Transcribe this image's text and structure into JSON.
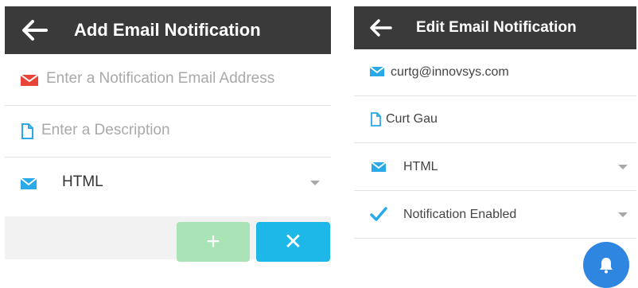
{
  "add_panel": {
    "title": "Add Email Notification",
    "email": {
      "placeholder": "Enter a Notification Email Address",
      "value": ""
    },
    "description": {
      "placeholder": "Enter a Description",
      "value": ""
    },
    "format": {
      "selected": "HTML"
    },
    "buttons": {
      "add": "+",
      "cancel": "✕"
    }
  },
  "edit_panel": {
    "title": "Edit Email Notification",
    "email": "curtg@innovsys.com",
    "description": "Curt Gau",
    "format": {
      "selected": "HTML"
    },
    "status": {
      "selected": "Notification Enabled"
    }
  },
  "colors": {
    "header_bg": "#3a3a3a",
    "email_icon_red": "#e8443a",
    "icon_blue": "#29a9e8",
    "add_button": "#a9e3b6",
    "cancel_button": "#1eb8e8",
    "fab": "#2f86e0"
  },
  "icons": [
    "back-arrow-icon",
    "envelope-icon",
    "document-icon",
    "check-icon",
    "chevron-down-icon",
    "bell-icon"
  ]
}
